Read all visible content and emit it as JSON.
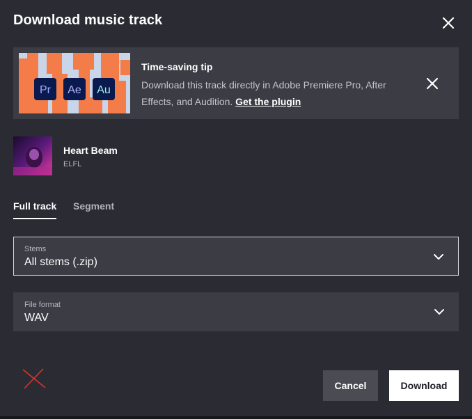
{
  "dialog": {
    "title": "Download music track"
  },
  "banner": {
    "heading": "Time-saving tip",
    "body_text": "Download this track directly in Adobe Premiere Pro, After Effects, and Audition.",
    "link_label": "Get the plugin",
    "app_badges": [
      "Pr",
      "Ae",
      "Au"
    ]
  },
  "track": {
    "title": "Heart Beam",
    "artist": "ELFL"
  },
  "tabs": [
    {
      "label": "Full track",
      "active": true
    },
    {
      "label": "Segment",
      "active": false
    }
  ],
  "stems_select": {
    "label": "Stems",
    "value": "All stems (.zip)"
  },
  "format_select": {
    "label": "File format",
    "value": "WAV"
  },
  "actions": {
    "cancel_label": "Cancel",
    "download_label": "Download"
  },
  "colors": {
    "background": "#2b2c33",
    "panel": "#3b3c44",
    "banner_orange": "#f47c48",
    "banner_blue": "#c9d6ea",
    "badge_navy": "#0b1a4e",
    "x_mark": "#e0302c"
  }
}
